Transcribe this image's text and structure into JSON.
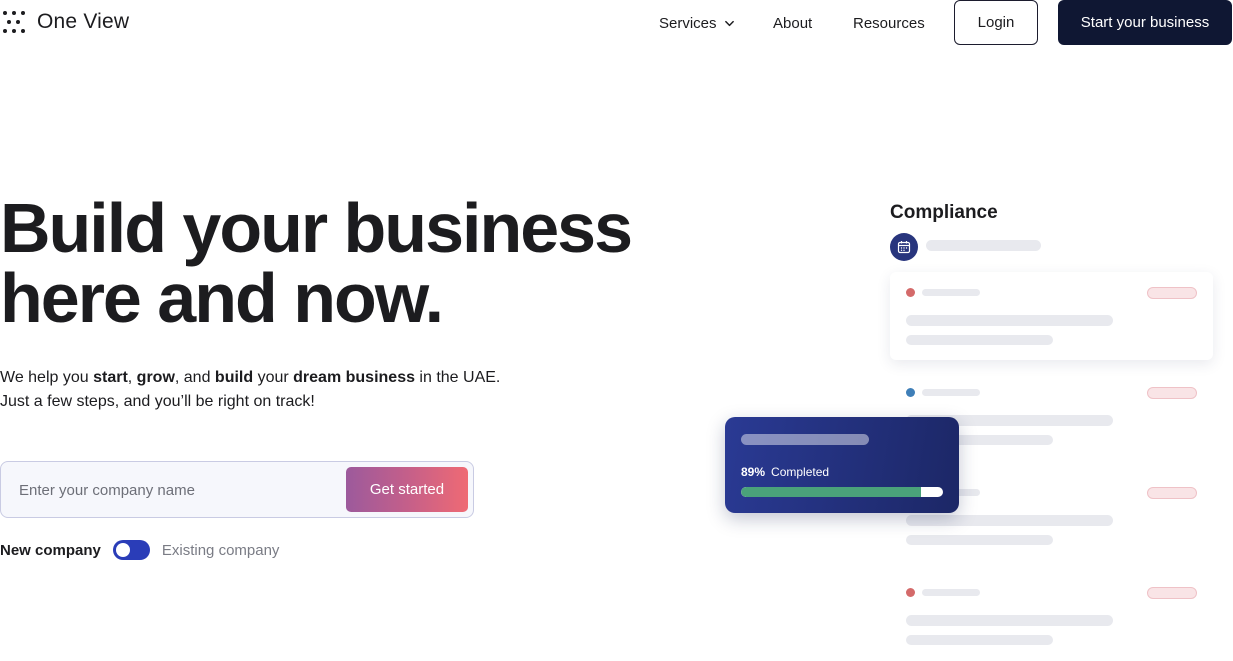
{
  "brand": {
    "name": "One View"
  },
  "nav": {
    "services": "Services",
    "about": "About",
    "resources": "Resources",
    "login": "Login",
    "start": "Start your business"
  },
  "hero": {
    "title_line1": "Build your business",
    "title_line2": "here and now.",
    "sub": {
      "p1": "We help you ",
      "start": "start",
      "p2": ", ",
      "grow": "grow",
      "p3": ", and ",
      "build": "build",
      "p4": " your ",
      "dream": "dream business",
      "p5": " in the UAE.",
      "line2": "Just a few steps, and you’ll be right on track!"
    },
    "input_placeholder": "Enter your company name",
    "cta": "Get started",
    "toggle_new": "New company",
    "toggle_existing": "Existing company"
  },
  "compliance": {
    "title": "Compliance",
    "progress_percent": "89%",
    "progress_label": "Completed",
    "progress_fraction": 0.89
  },
  "colors": {
    "nav_dark": "#0f1733",
    "toggle": "#2a3db8",
    "progress_fill": "#4aa27a",
    "dot_red": "#d46a6a",
    "dot_blue": "#3f7fb8"
  }
}
